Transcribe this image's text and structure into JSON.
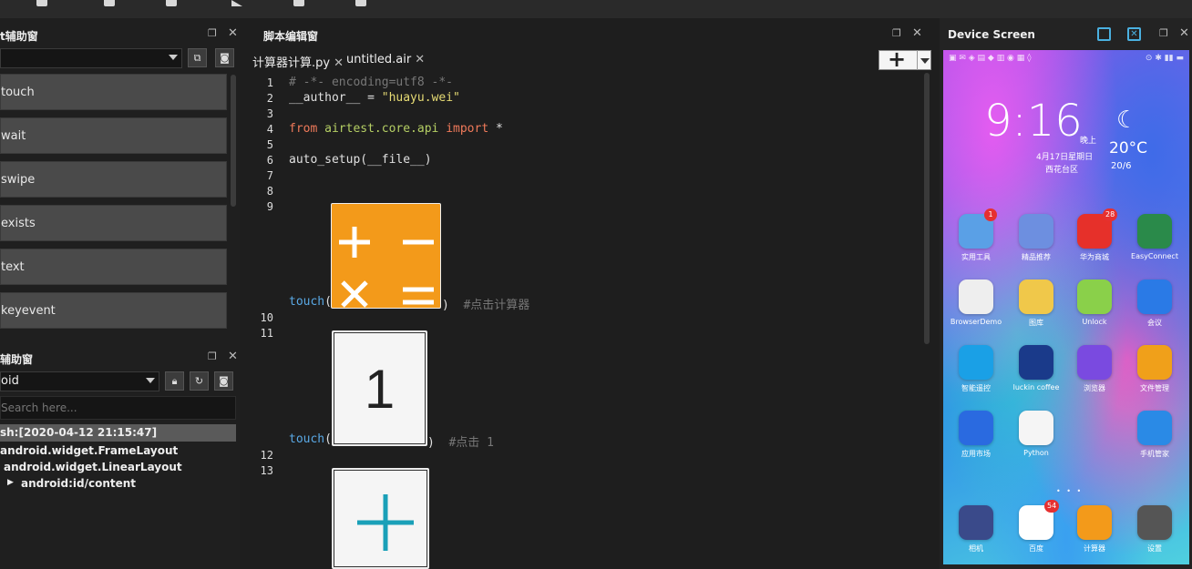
{
  "left_panel": {
    "api_title": "t辅助窗",
    "api_buttons": [
      "touch",
      "wait",
      "swipe",
      "exists",
      "text",
      "keyevent"
    ],
    "poco_title": "辅助窗",
    "poco_mode": "oid",
    "search_placeholder": "Search here...",
    "tree": [
      "sh:[2020-04-12 21:15:47]",
      "android.widget.FrameLayout",
      "android.widget.LinearLayout",
      "android:id/content"
    ]
  },
  "editor": {
    "title": "脚本编辑窗",
    "tabs": [
      {
        "label": "计算器计算.py",
        "close": "✕"
      },
      {
        "label": "untitled.air",
        "close": "✕"
      }
    ],
    "add_label": "+",
    "line_numbers": [
      "1",
      "2",
      "3",
      "4",
      "5",
      "6",
      "7",
      "8",
      "9",
      "10",
      "11",
      "12",
      "13"
    ],
    "code": {
      "l1": "# -*- encoding=utf8 -*-",
      "l2_a": "__author__ = ",
      "l2_b": "\"huayu.wei\"",
      "l4_from": "from",
      "l4_mod": "airtest.core.api",
      "l4_import": "import",
      "l4_star": " *",
      "l6": "auto_setup(__file__)",
      "touch": "touch",
      "paren_open": "(",
      "paren_close": ")",
      "comment_9": "#点击计算器",
      "comment_11": "#点击 1",
      "image_11_text": "1"
    }
  },
  "device": {
    "title": "Device Screen",
    "clock": "9:16",
    "ampm": "晚上",
    "date": "4月17日星期日",
    "location": "西花台区",
    "temperature": "20°C",
    "temp_range": "20/6",
    "apps": [
      {
        "label": "实用工具",
        "badge": "1",
        "color": "#5aa0e6"
      },
      {
        "label": "精品推荐",
        "badge": "",
        "color": "#6d8fe0"
      },
      {
        "label": "华为商城",
        "badge": "28",
        "color": "#e6302a"
      },
      {
        "label": "EasyConnect",
        "badge": "",
        "color": "#2a8a4a"
      },
      {
        "label": "BrowserDemo",
        "badge": "",
        "color": "#eeeeee"
      },
      {
        "label": "图库",
        "badge": "",
        "color": "#f0c84a"
      },
      {
        "label": "Unlock",
        "badge": "",
        "color": "#8ad04a"
      },
      {
        "label": "会议",
        "badge": "",
        "color": "#2a7ae6"
      },
      {
        "label": "智能遥控",
        "badge": "",
        "color": "#1aa0e6"
      },
      {
        "label": "luckin coffee",
        "badge": "",
        "color": "#1a3a8a"
      },
      {
        "label": "浏览器",
        "badge": "",
        "color": "#7a4ae0"
      },
      {
        "label": "文件管理",
        "badge": "",
        "color": "#f0a01a"
      },
      {
        "label": "应用市场",
        "badge": "",
        "color": "#2a6ae0"
      },
      {
        "label": "Python",
        "badge": "",
        "color": "#f5f5f5"
      },
      {
        "label": "",
        "badge": "",
        "color": "transparent"
      },
      {
        "label": "手机管家",
        "badge": "",
        "color": "#2a8ae6"
      }
    ],
    "dock": [
      {
        "label": "相机",
        "badge": "",
        "color": "#3a4a8a"
      },
      {
        "label": "百度",
        "badge": "54",
        "color": "#ffffff"
      },
      {
        "label": "计算器",
        "badge": "",
        "color": "#f39a1a"
      },
      {
        "label": "设置",
        "badge": "",
        "color": "#555555"
      }
    ]
  }
}
